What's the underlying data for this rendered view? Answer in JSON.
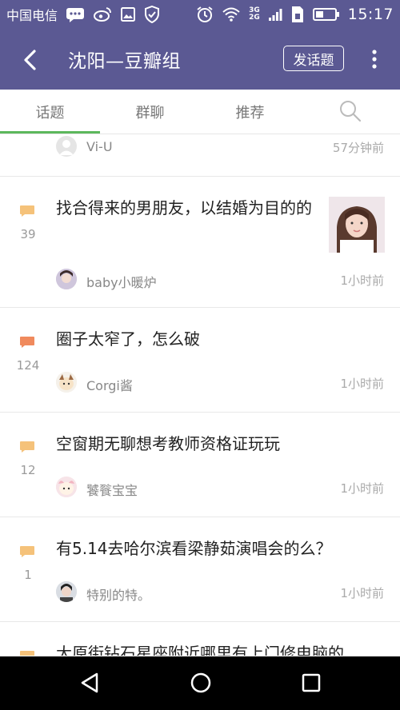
{
  "status_bar": {
    "carrier": "中国电信",
    "network_top": "3G",
    "network_bottom": "2G",
    "network_top2": "3G",
    "network_bottom2": "2G",
    "time": "15:17"
  },
  "app_bar": {
    "title": "沈阳—豆瓣组",
    "post_button": "发话题"
  },
  "tabs": [
    "话题",
    "群聊",
    "推荐"
  ],
  "active_tab": "话题",
  "colors": {
    "accent": "#5b5993",
    "tab_indicator": "#5cb85c",
    "badge_normal": "#f5c27a",
    "badge_hot": "#f08a5d"
  },
  "topics": [
    {
      "title": "",
      "count": "",
      "author": "Vi-U",
      "time": "57分钟前",
      "badge": "none"
    },
    {
      "title": "找合得来的男朋友，以结婚为目的的",
      "count": "39",
      "author": "baby小暖炉",
      "time": "1小时前",
      "badge": "normal"
    },
    {
      "title": "圈子太窄了，怎么破",
      "count": "124",
      "author": "Corgi酱",
      "time": "1小时前",
      "badge": "hot"
    },
    {
      "title": "空窗期无聊想考教师资格证玩玩",
      "count": "12",
      "author": "饕餮宝宝",
      "time": "1小时前",
      "badge": "normal"
    },
    {
      "title": "有5.14去哈尔滨看梁静茹演唱会的么？",
      "count": "1",
      "author": "特别的特。",
      "time": "1小时前",
      "badge": "normal"
    },
    {
      "title": "大原街钻石星座附近哪里有上门修电脑的",
      "count": "",
      "author": "",
      "time": "",
      "badge": "normal"
    }
  ]
}
